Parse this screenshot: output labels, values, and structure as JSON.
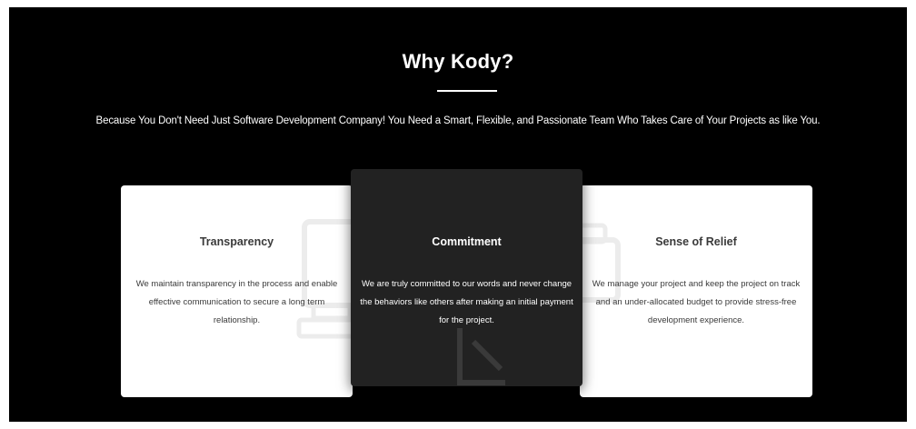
{
  "section": {
    "heading": "Why Kody?",
    "subtitle": "Because You Don't Need Just Software Development Company! You Need a Smart, Flexible, and Passionate Team Who Takes Care of Your Projects as like You."
  },
  "cards": [
    {
      "title": "Transparency",
      "text": "We maintain transparency in the process and enable effective communication to secure a long term relationship.",
      "icon": "monitor-icon"
    },
    {
      "title": "Commitment",
      "text": "We are truly committed to our words and never change the behaviors like others after making an initial payment for the project.",
      "icon": "handshake-icon"
    },
    {
      "title": "Sense of Relief",
      "text": "We manage your project and keep the project on track and an under-allocated budget to provide stress-free development experience.",
      "icon": "briefcase-icon"
    }
  ],
  "colors": {
    "background": "#000000",
    "card_light": "#ffffff",
    "card_dark": "#222222",
    "text_light": "#ffffff",
    "text_dark": "#3a3a3a"
  }
}
